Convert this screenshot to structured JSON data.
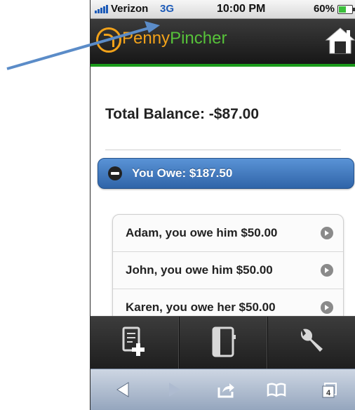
{
  "status_bar": {
    "carrier": "Verizon",
    "network": "3G",
    "time": "10:00 PM",
    "battery_percent": "60%",
    "battery_level": 0.6
  },
  "header": {
    "brand_part1": "Penny",
    "brand_part2": "Pincher",
    "home_icon": "home-icon",
    "colors": {
      "brand_orange": "#f2a21a",
      "brand_green": "#57c23a",
      "header_rule": "#1a9a1a"
    }
  },
  "main": {
    "total_balance": "Total Balance: -$87.00",
    "you_owe_header": "You Owe: $187.50",
    "debts": [
      {
        "text": "Adam, you owe him $50.00"
      },
      {
        "text": "John, you owe him $50.00"
      },
      {
        "text": "Karen, you owe her $50.00"
      }
    ],
    "accent_color": "#3f77c2"
  },
  "app_toolbar": {
    "icons": [
      "add-document-icon",
      "notebook-icon",
      "wrench-icon"
    ]
  },
  "browser_toolbar": {
    "icons": [
      "back-arrow-icon",
      "forward-arrow-icon",
      "share-icon",
      "bookmarks-icon",
      "tabs-icon"
    ],
    "tabs_count": "4"
  }
}
